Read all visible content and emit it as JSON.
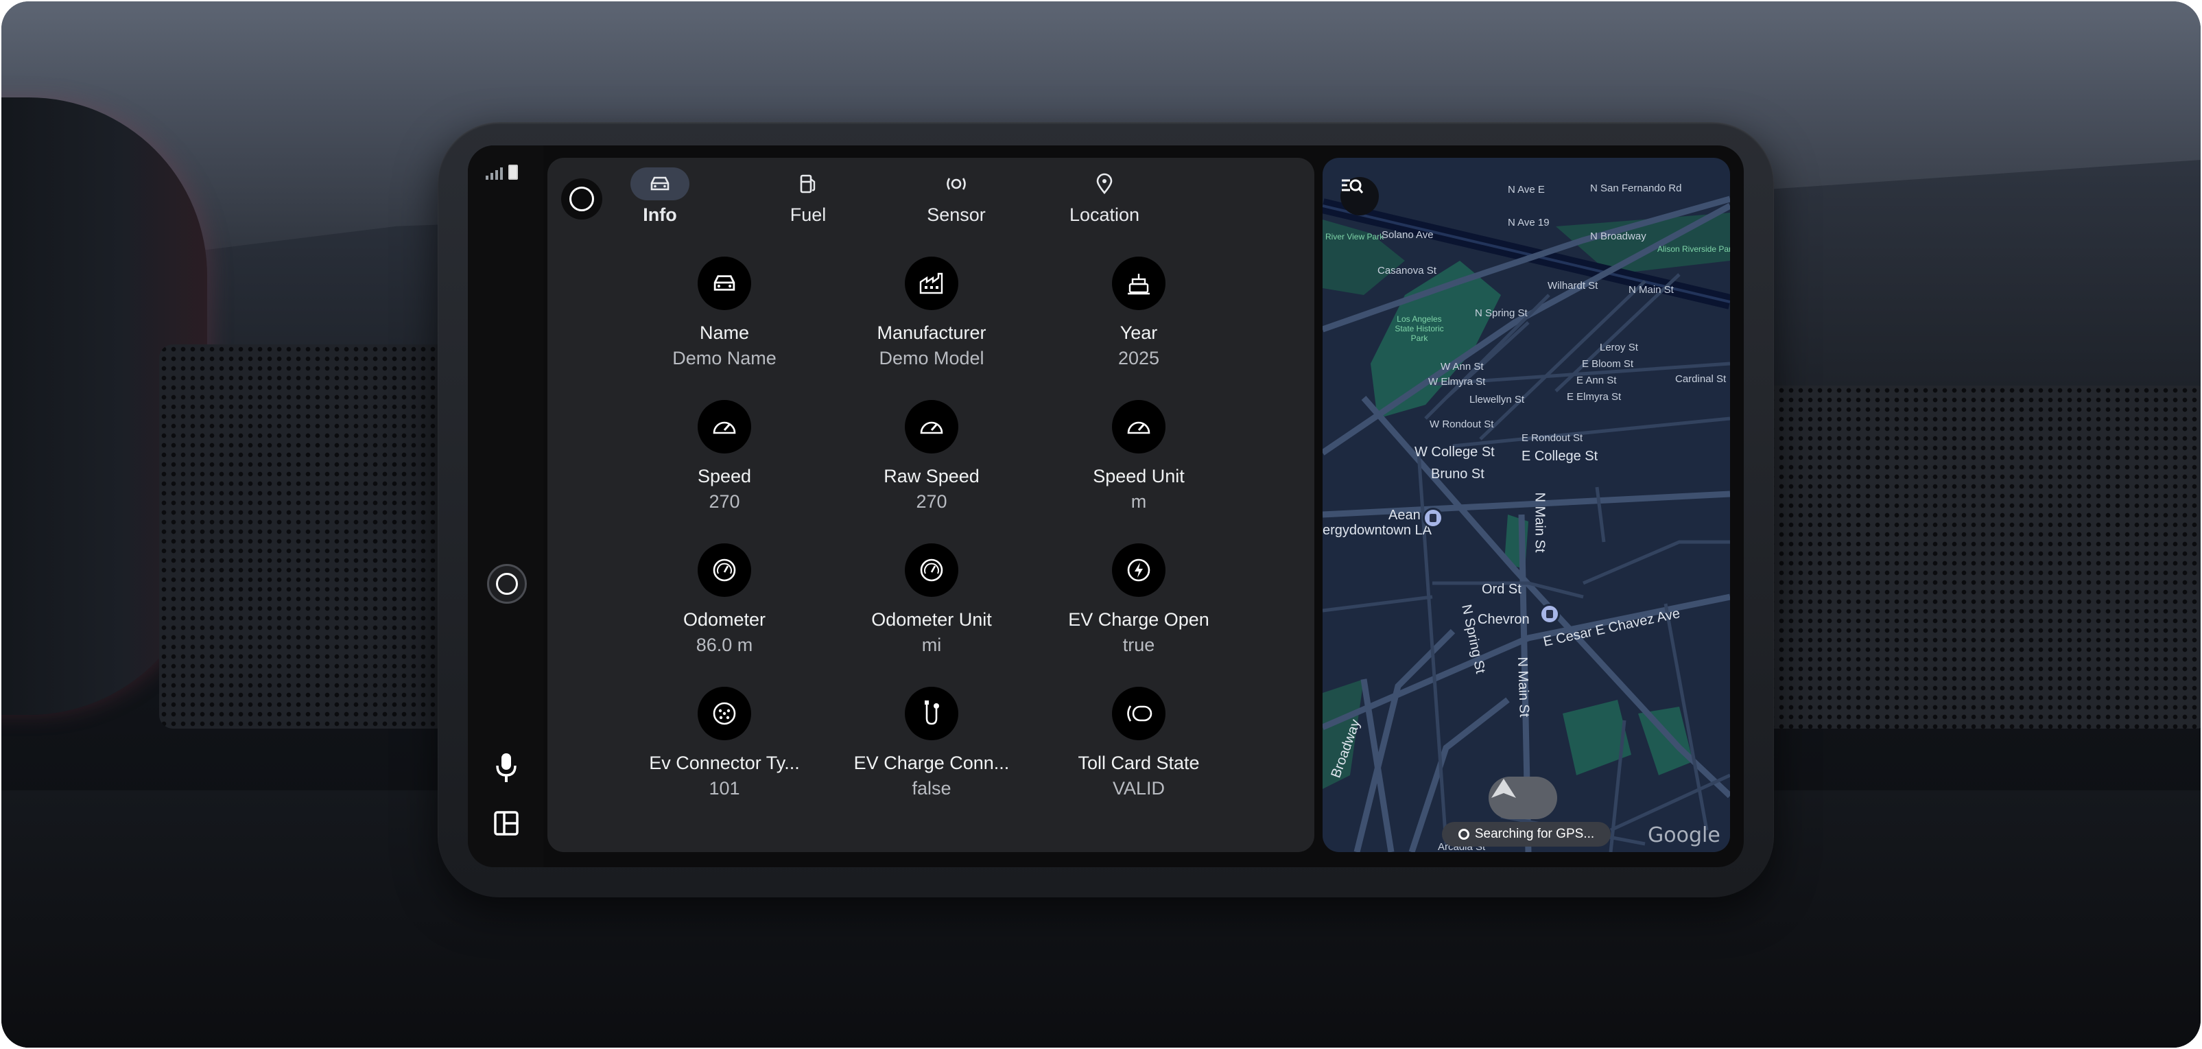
{
  "tabs": [
    {
      "label": "Info",
      "icon": "car-icon",
      "active": true
    },
    {
      "label": "Fuel",
      "icon": "fuel-icon",
      "active": false
    },
    {
      "label": "Sensor",
      "icon": "sensor-icon",
      "active": false
    },
    {
      "label": "Location",
      "icon": "location-pin-icon",
      "active": false
    }
  ],
  "info": [
    {
      "title": "Name",
      "value": "Demo Name",
      "icon": "car-icon"
    },
    {
      "title": "Manufacturer",
      "value": "Demo Model",
      "icon": "factory-icon"
    },
    {
      "title": "Year",
      "value": "2025",
      "icon": "cake-icon"
    },
    {
      "title": "Speed",
      "value": "270",
      "icon": "speedometer-icon"
    },
    {
      "title": "Raw Speed",
      "value": "270",
      "icon": "speedometer-icon"
    },
    {
      "title": "Speed Unit",
      "value": "m",
      "icon": "speedometer-icon"
    },
    {
      "title": "Odometer",
      "value": "86.0 m",
      "icon": "odometer-icon"
    },
    {
      "title": "Odometer Unit",
      "value": "mi",
      "icon": "odometer-icon"
    },
    {
      "title": "EV Charge Open",
      "value": "true",
      "icon": "ev-charge-icon"
    },
    {
      "title": "Ev Connector Ty...",
      "value": "101",
      "icon": "ev-connector-icon"
    },
    {
      "title": "EV Charge Conn...",
      "value": "false",
      "icon": "ev-cable-icon"
    },
    {
      "title": "Toll Card State",
      "value": "VALID",
      "icon": "toll-card-icon"
    }
  ],
  "map": {
    "gps_status": "Searching for GPS...",
    "attribution": "Google",
    "labels": {
      "ave_e": "N Ave E",
      "san_fernando": "N San Fernando Rd",
      "ave_19": "N Ave 19",
      "broadway": "N Broadway",
      "river_view": "River View Park",
      "alison": "Alison Riverside Park",
      "solano": "Solano Ave",
      "casanova": "Casanova St",
      "wilhardt": "Wilhardt St",
      "main_n": "N Main St",
      "la_park": "Los Angeles State Historic Park",
      "spring_n": "N Spring St",
      "leroy": "Leroy St",
      "w_ann": "W Ann St",
      "e_bloom": "E Bloom St",
      "w_elmyra": "W Elmyra St",
      "e_ann": "E Ann St",
      "cardinal": "Cardinal St",
      "llewellyn": "Llewellyn St",
      "e_elmyra": "E Elmyra St",
      "w_rondout": "W Rondout St",
      "e_rondout": "E Rondout St",
      "w_college": "W College St",
      "e_college": "E College St",
      "bruno": "Bruno St",
      "aean": "Aean",
      "energy": "ergydowntown LA",
      "main_s": "N Main St",
      "ord": "Ord St",
      "spring_s": "N Spring St",
      "chevron": "Chevron",
      "cesar": "E Cesar E Chavez Ave",
      "main_s2": "N Main St",
      "broadway_s": "Broadway",
      "arcadia": "Arcadia St"
    }
  }
}
